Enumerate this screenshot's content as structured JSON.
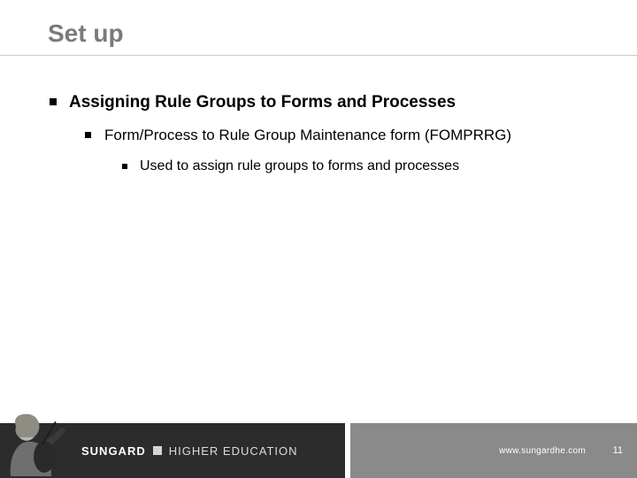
{
  "title": "Set up",
  "bullets": {
    "l1": "Assigning Rule Groups to Forms and Processes",
    "l2": "Form/Process to Rule Group Maintenance form (FOMPRRG)",
    "l3": "Used to assign rule groups to forms and processes"
  },
  "footer": {
    "brand_bold": "SUNGARD",
    "brand_light": "HIGHER EDUCATION",
    "url": "www.sungardhe.com",
    "page": "11"
  }
}
